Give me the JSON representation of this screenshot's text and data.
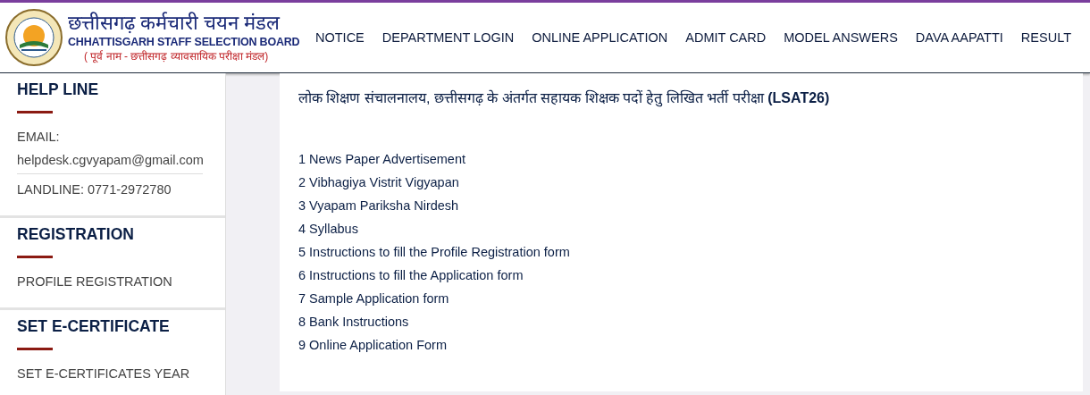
{
  "header": {
    "title_hindi": "छत्तीसगढ़ कर्मचारी चयन मंडल",
    "title_english": "CHHATTISGARH STAFF SELECTION BOARD",
    "former_name": "( पूर्व नाम - छत्तीसगढ़ व्यावसायिक परीक्षा मंडल)",
    "nav": [
      "NOTICE",
      "DEPARTMENT LOGIN",
      "ONLINE APPLICATION",
      "ADMIT CARD",
      "MODEL ANSWERS",
      "DAVA AAPATTI",
      "RESULT"
    ]
  },
  "sidebar": [
    {
      "heading": "HELP LINE",
      "items": [
        {
          "kind": "label",
          "text": "EMAIL:"
        },
        {
          "kind": "email",
          "text": "helpdesk.cgvyapam@gmail.com"
        },
        {
          "kind": "label",
          "text": "LANDLINE: 0771-2972780"
        }
      ]
    },
    {
      "heading": "REGISTRATION",
      "items": [
        {
          "kind": "link",
          "text": "PROFILE REGISTRATION"
        }
      ]
    },
    {
      "heading": "SET E-CERTIFICATE",
      "items": [
        {
          "kind": "link",
          "text": "SET E-CERTIFICATES YEAR"
        }
      ]
    }
  ],
  "content": {
    "title": "लोक शिक्षण संचालनालय, छत्तीसगढ़ के अंतर्गत सहायक शिक्षक पदों हेतु लिखित भर्ती परीक्षा **(LSAT26)**",
    "links": [
      "1 News Paper Advertisement",
      "2 Vibhagiya Vistrit Vigyapan",
      "3 Vyapam Pariksha Nirdesh",
      "4 Syllabus",
      "5 Instructions to fill the Profile Registration form",
      "6 Instructions to fill the Application form",
      "7 Sample Application form",
      "8 Bank Instructions",
      "9 Online Application Form"
    ]
  }
}
